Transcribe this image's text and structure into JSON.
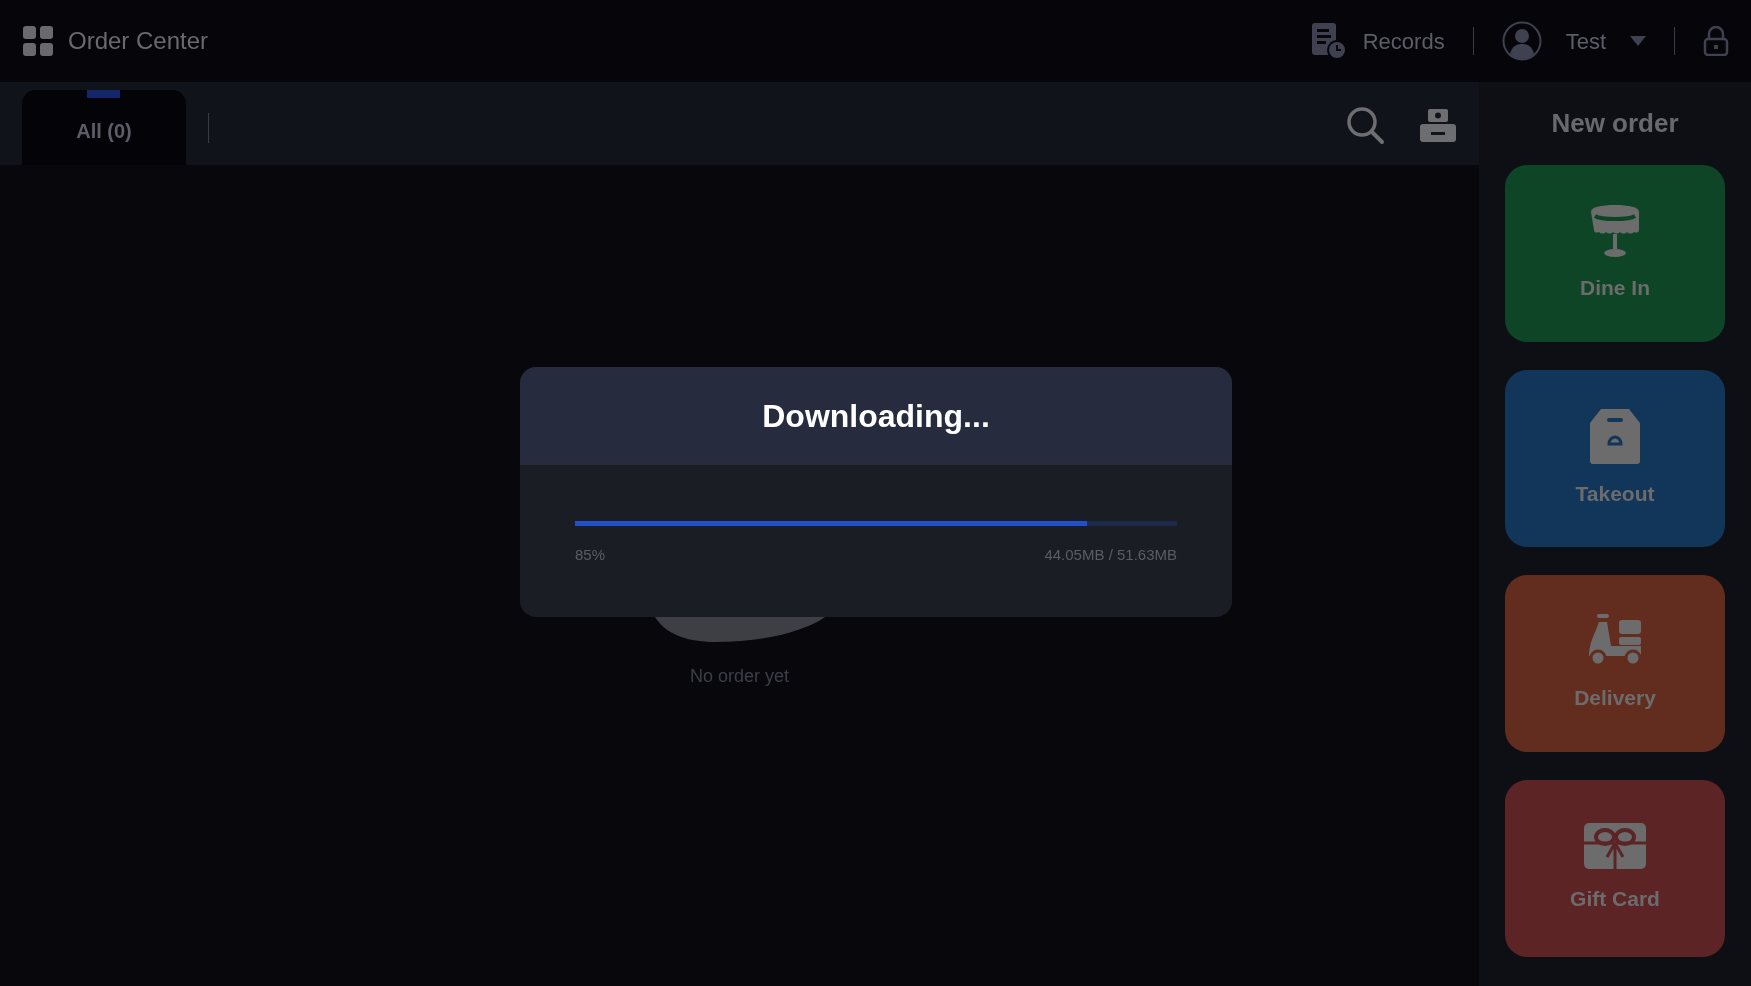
{
  "app_title": "Order Center",
  "header": {
    "records_label": "Records",
    "user_name": "Test"
  },
  "tabs": [
    {
      "label": "All (0)",
      "selected": true
    }
  ],
  "empty_state": {
    "message": "No order yet"
  },
  "dialog": {
    "title": "Downloading...",
    "level": 0.85,
    "percent": "85%",
    "size": "44.05MB / 51.63MB"
  },
  "new_order": {
    "title": "New order",
    "options": [
      {
        "label": "Dine In",
        "kind": "dine_in",
        "color": "#0d4526"
      },
      {
        "label": "Takeout",
        "kind": "takeout",
        "color": "#12355a"
      },
      {
        "label": "Delivery",
        "kind": "delivery",
        "color": "#622d1f"
      },
      {
        "label": "Gift Card",
        "kind": "gift_card",
        "color": "#5c2424"
      }
    ]
  }
}
